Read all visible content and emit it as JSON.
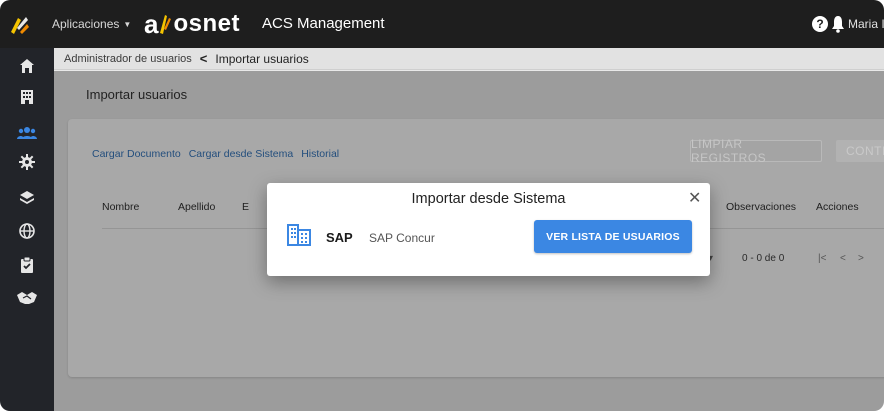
{
  "topbar": {
    "apps_label": "Aplicaciones",
    "brand_a": "a",
    "brand_net": "osnet",
    "app_title": "ACS Management",
    "help_glyph": "?",
    "user_name": "Maria I"
  },
  "sidebar": {
    "icons": [
      "home-icon",
      "building-icon",
      "users-icon",
      "gear-icon",
      "layers-icon",
      "globe-icon",
      "clipboard-check-icon",
      "handshake-icon"
    ],
    "active": "users-icon",
    "accent": "#3b87e3"
  },
  "breadcrumb": {
    "parent": "Administrador de usuarios",
    "separator": "<",
    "current": "Importar usuarios"
  },
  "page": {
    "heading": "Importar usuarios",
    "links": [
      "Cargar Documento",
      "Cargar desde Sistema",
      "Historial"
    ],
    "clear_button": "LIMPIAR REGISTROS",
    "continue_button": "CONTI",
    "table_headers": [
      "Nombre",
      "Apellido",
      "E",
      "Observaciones",
      "Acciones"
    ],
    "pager": {
      "rows_caret": "▾",
      "range": "0 - 0 de 0",
      "first": "|<",
      "prev": "<",
      "next": ">"
    }
  },
  "modal": {
    "title": "Importar desde Sistema",
    "close_glyph": "✕",
    "system_name": "SAP",
    "system_desc": "SAP Concur",
    "action_button": "VER LISTA DE USUARIOS",
    "button_color": "#3b87e3"
  }
}
